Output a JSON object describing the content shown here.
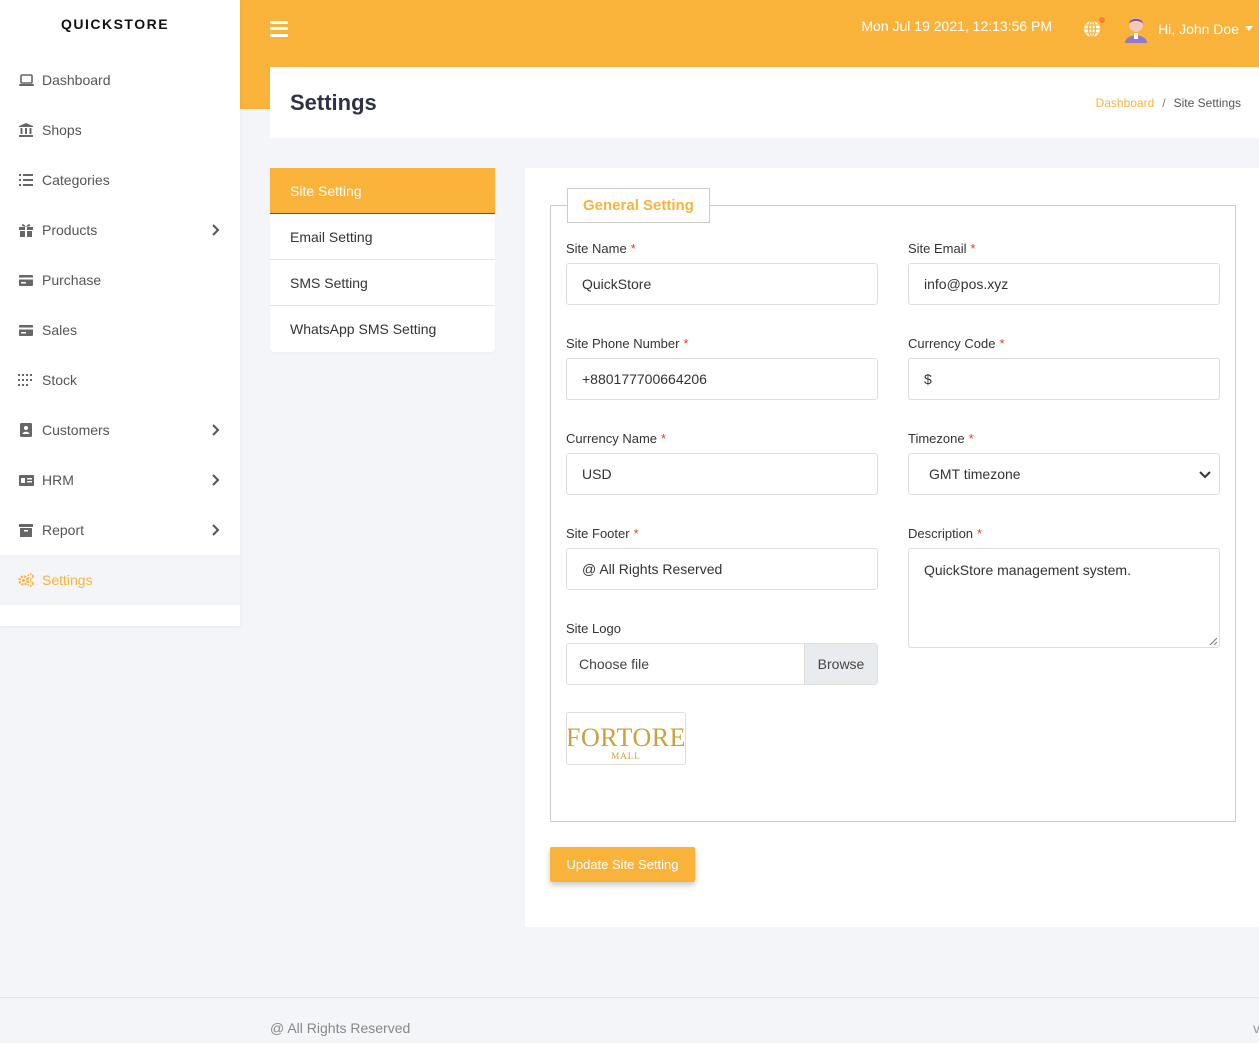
{
  "brand": "QUICKSTORE",
  "sidebar": {
    "items": [
      {
        "label": "Dashboard",
        "icon": "laptop-icon"
      },
      {
        "label": "Shops",
        "icon": "bank-icon"
      },
      {
        "label": "Categories",
        "icon": "list-icon"
      },
      {
        "label": "Products",
        "icon": "gift-icon"
      },
      {
        "label": "Purchase",
        "icon": "card-icon"
      },
      {
        "label": "Sales",
        "icon": "card-icon"
      },
      {
        "label": "Stock",
        "icon": "grid-dots-icon"
      },
      {
        "label": "Customers",
        "icon": "address-book-icon"
      },
      {
        "label": "HRM",
        "icon": "id-card-icon"
      },
      {
        "label": "Report",
        "icon": "archive-icon"
      },
      {
        "label": "Settings",
        "icon": "cogs-icon"
      }
    ]
  },
  "topbar": {
    "datetime": "Mon Jul 19 2021, 12:13:56 PM",
    "user_greeting": "Hi, John Doe"
  },
  "header": {
    "title": "Settings",
    "breadcrumb_home": "Dashboard",
    "breadcrumb_sep": "/",
    "breadcrumb_current": "Site Settings"
  },
  "tabs": [
    {
      "label": "Site Setting"
    },
    {
      "label": "Email Setting"
    },
    {
      "label": "SMS Setting"
    },
    {
      "label": "WhatsApp SMS Setting"
    }
  ],
  "form": {
    "legend": "General Setting",
    "required_mark": "*",
    "site_name_label": "Site Name",
    "site_name_value": "QuickStore",
    "site_email_label": "Site Email",
    "site_email_value": "info@pos.xyz",
    "site_phone_label": "Site Phone Number",
    "site_phone_value": "+880177700664206",
    "currency_code_label": "Currency Code",
    "currency_code_value": "$",
    "currency_name_label": "Currency Name",
    "currency_name_value": "USD",
    "timezone_label": "Timezone",
    "timezone_value": "GMT timezone",
    "site_footer_label": "Site Footer",
    "site_footer_value": "@ All Rights Reserved",
    "description_label": "Description",
    "description_value": "QuickStore management system.",
    "site_logo_label": "Site Logo",
    "file_placeholder": "Choose file",
    "browse_label": "Browse",
    "logo_text_main": "FORTORE",
    "logo_text_sub": "MALL",
    "submit_label": "Update Site Setting"
  },
  "footer": {
    "text": "@ All Rights Reserved",
    "right_text": "v"
  },
  "colors": {
    "accent": "#f9b33b",
    "required": "#e53935",
    "title": "#2f3247"
  }
}
